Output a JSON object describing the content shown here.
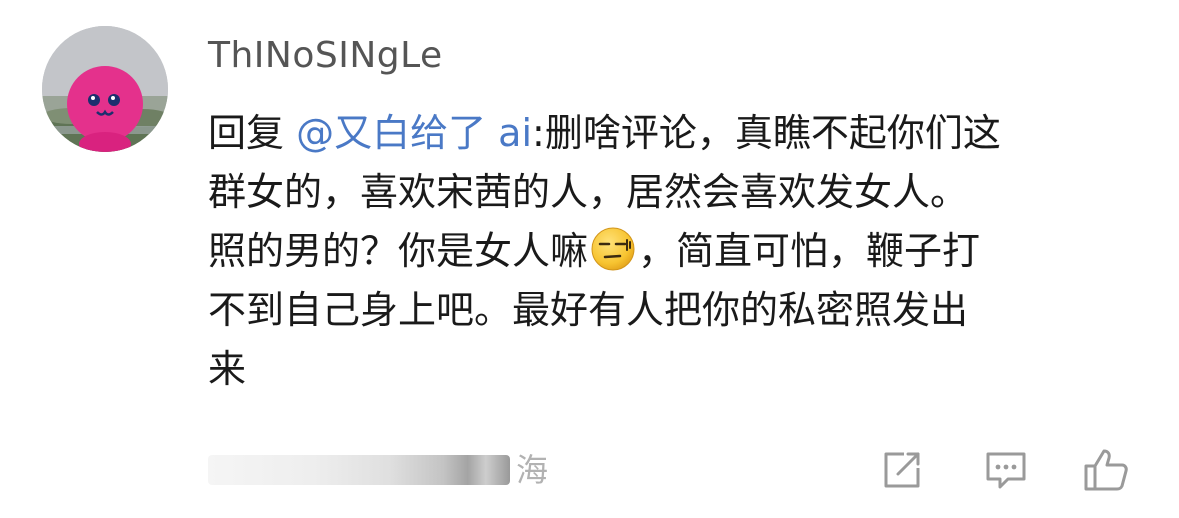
{
  "comment": {
    "username": "ThINoSINgLe",
    "lines": [
      {
        "prefix": "回复 ",
        "mention": "@又白给了 ai",
        "text": ":删啥评论，真瞧不起你们这"
      },
      {
        "text": "群女的，喜欢宋茜的人，居然会喜欢发女人。"
      },
      {
        "text_before_emoji": "照的男的？你是女人嘛",
        "text_after_emoji": "，简直可怕，鞭子打"
      },
      {
        "text": "不到自己身上吧。最好有人把你的私密照发出"
      },
      {
        "text": "来"
      }
    ],
    "emoji": "bored-face-emoji",
    "meta_suffix": "海"
  },
  "actions": {
    "share_icon": "share-icon",
    "comment_icon": "comment-icon",
    "like_icon": "thumbs-up-icon"
  },
  "colors": {
    "mention": "#4a79c6",
    "username": "#555555",
    "body_text": "#1a1a1a",
    "meta_text": "#b2b2b2",
    "icon": "#9a9a9a"
  }
}
